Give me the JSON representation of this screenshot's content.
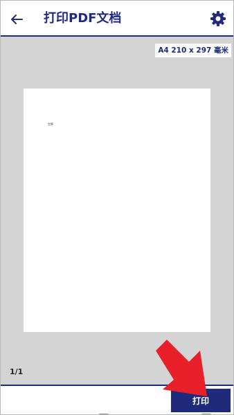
{
  "header": {
    "title": "打印PDF文档",
    "back_icon": "arrow-left-icon",
    "settings_icon": "gear-icon"
  },
  "preview": {
    "paper_size": "A4 210 x 297 毫米",
    "page_counter": "1/1",
    "sheet_text": "世界"
  },
  "footer": {
    "print_label": "打印"
  },
  "colors": {
    "accent": "#1f2a7a",
    "preview_background": "#d4d4d4",
    "annotation_arrow": "#e8202a"
  }
}
